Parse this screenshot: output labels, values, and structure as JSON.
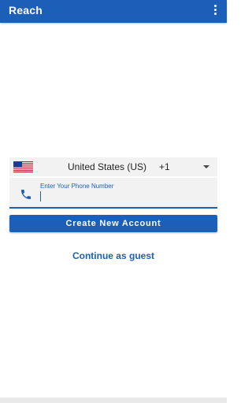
{
  "app_bar": {
    "title": "Reach",
    "menu_icon": "more-vert-icon"
  },
  "colors": {
    "primary": "#1c5fb8",
    "field_background": "#f2f2f2"
  },
  "country_selector": {
    "flag_icon": "us-flag-icon",
    "country": "United States (US)",
    "dial_code": "+1",
    "dropdown_icon": "arrow-drop-down-icon"
  },
  "phone_field": {
    "icon": "phone-icon",
    "label": "Enter Your Phone Number",
    "value": ""
  },
  "actions": {
    "create_account": "Create New Account",
    "continue_guest": "Continue as guest"
  }
}
